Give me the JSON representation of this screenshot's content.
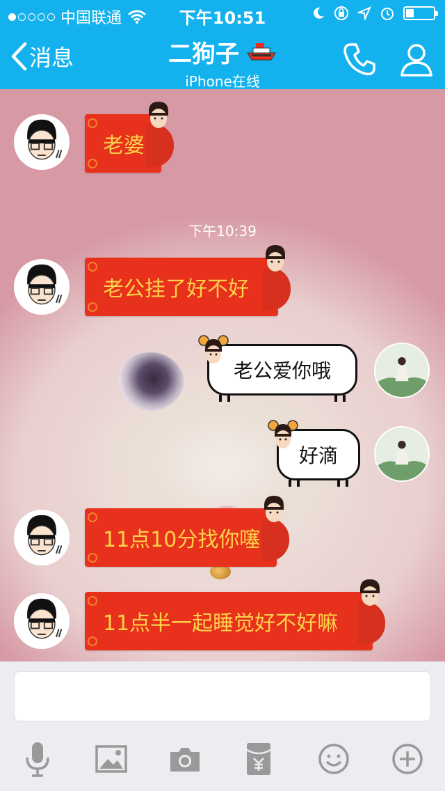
{
  "status_bar": {
    "carrier": "中国联通",
    "time": "下午10:51",
    "signal_dots_filled": 1,
    "signal_dots_total": 5,
    "battery_level": 0.3
  },
  "nav": {
    "back_label": "消息",
    "title": "二狗子",
    "subtitle": "iPhone在线"
  },
  "chat": {
    "timestamp": "下午10:39",
    "messages": [
      {
        "side": "left",
        "style": "red",
        "text": "老婆"
      },
      {
        "side": "left",
        "style": "red",
        "text": "老公挂了好不好"
      },
      {
        "side": "right",
        "style": "sheep",
        "text": "老公爱你哦"
      },
      {
        "side": "right",
        "style": "sheep",
        "text": "好滴"
      },
      {
        "side": "left",
        "style": "red",
        "text": "11点10分找你噻"
      },
      {
        "side": "left",
        "style": "red",
        "text": "11点半一起睡觉好不好嘛"
      }
    ]
  },
  "input": {
    "placeholder": ""
  },
  "toolbar_icons": [
    "microphone-icon",
    "image-icon",
    "camera-icon",
    "red-packet-icon",
    "emoji-icon",
    "plus-icon"
  ],
  "colors": {
    "nav_blue": "#13b2ee",
    "red_bubble": "#e8311c",
    "red_bubble_text": "#ffd24a",
    "toolbar_icon": "#999999"
  }
}
